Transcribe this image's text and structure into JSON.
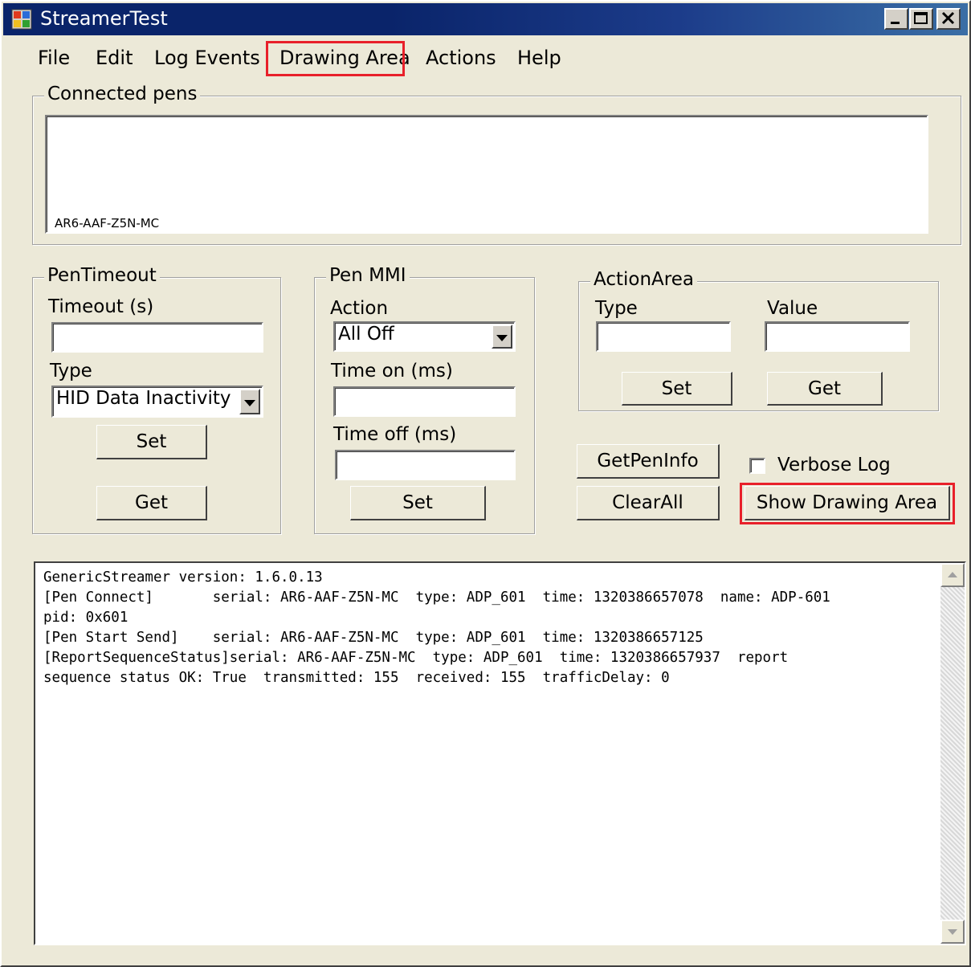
{
  "window": {
    "title": "StreamerTest",
    "icon": "app-window-icon",
    "controls": [
      "minimize-icon",
      "maximize-icon",
      "close-icon"
    ]
  },
  "menu": {
    "file": "File",
    "edit": "Edit",
    "log_events": "Log Events",
    "drawing_area": "Drawing Area",
    "actions": "Actions",
    "help": "Help"
  },
  "connected_pens": {
    "title": "Connected pens",
    "items": [
      "AR6-AAF-Z5N-MC"
    ]
  },
  "pen_timeout": {
    "title": "PenTimeout",
    "timeout_label": "Timeout (s)",
    "timeout_value": "",
    "type_label": "Type",
    "type_value": "HID Data Inactivity",
    "set_label": "Set",
    "get_label": "Get"
  },
  "pen_mmi": {
    "title": "Pen MMI",
    "action_label": "Action",
    "action_value": "All Off",
    "time_on_label": "Time on (ms)",
    "time_on_value": "",
    "time_off_label": "Time off (ms)",
    "time_off_value": "",
    "set_label": "Set"
  },
  "action_area": {
    "title": "ActionArea",
    "type_label": "Type",
    "type_value": "",
    "value_label": "Value",
    "value_value": "",
    "set_label": "Set",
    "get_label": "Get"
  },
  "buttons": {
    "get_pen_info": "GetPenInfo",
    "clear_all": "ClearAll",
    "show_drawing_area": "Show Drawing Area"
  },
  "verbose_log": {
    "label": "Verbose Log",
    "checked": false
  },
  "log": {
    "text": "GenericStreamer version: 1.6.0.13\n[Pen Connect]       serial: AR6-AAF-Z5N-MC  type: ADP_601  time: 1320386657078  name: ADP-601\npid: 0x601\n[Pen Start Send]    serial: AR6-AAF-Z5N-MC  type: ADP_601  time: 1320386657125\n[ReportSequenceStatus]serial: AR6-AAF-Z5N-MC  type: ADP_601  time: 1320386657937  report\nsequence status OK: True  transmitted: 155  received: 155  trafficDelay: 0"
  },
  "highlight_color": "#e8202a"
}
